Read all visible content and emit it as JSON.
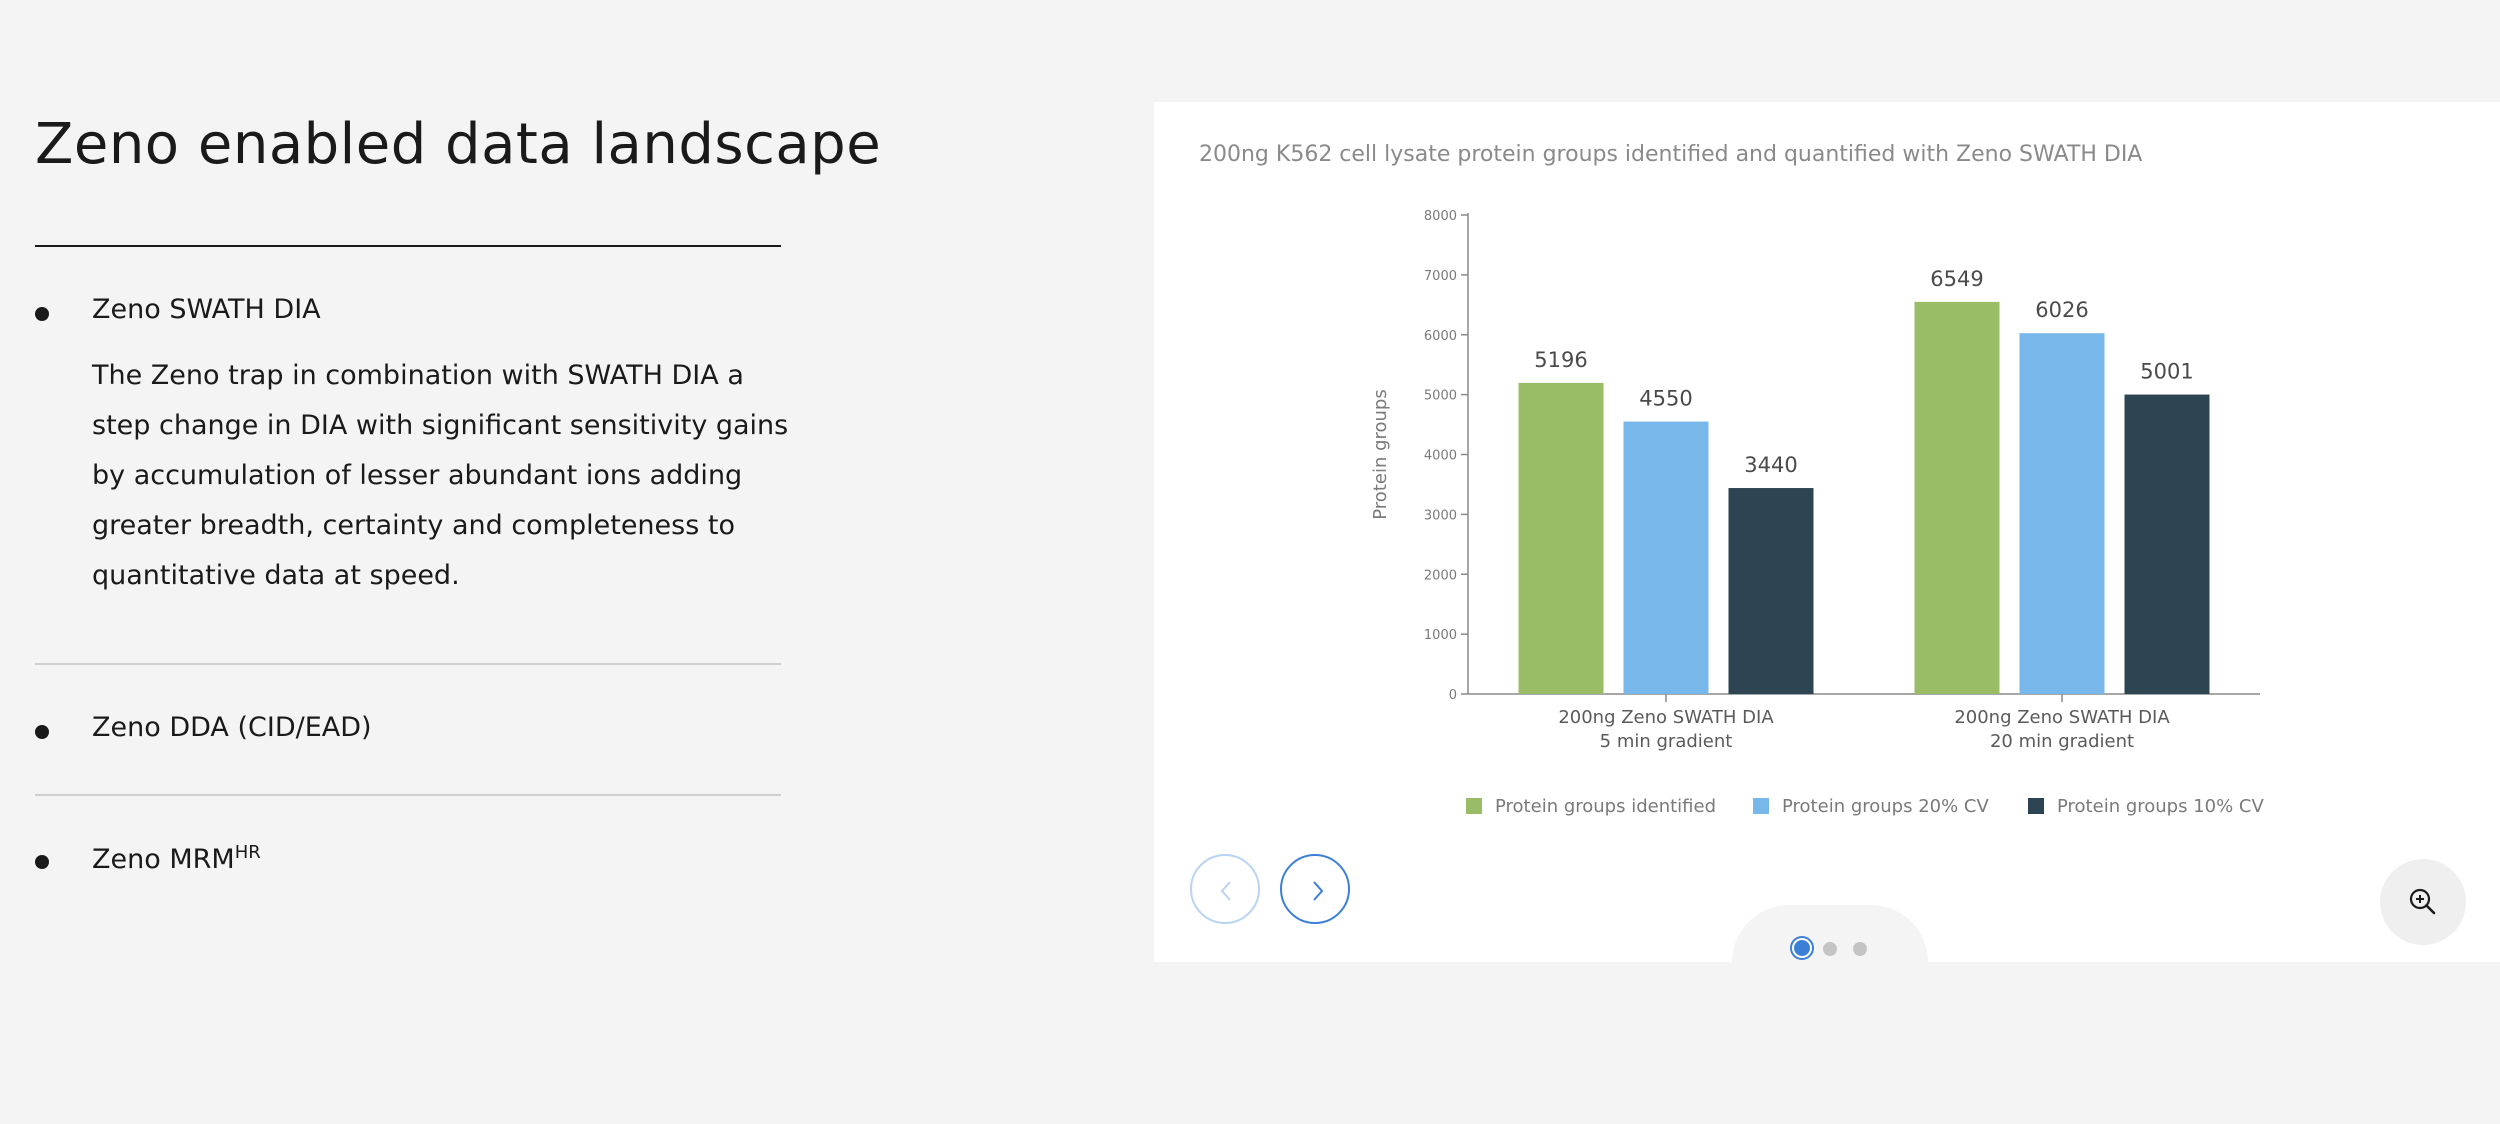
{
  "page": {
    "title": "Zeno enabled data landscape"
  },
  "accordion": {
    "items": [
      {
        "label": "Zeno SWATH DIA",
        "body": "The Zeno trap in combination with SWATH DIA a step change in DIA with significant sensitivity gains by accumulation of lesser abundant ions adding greater breadth, certainty and completeness to quantitative data at speed."
      },
      {
        "label": "Zeno DDA (CID/EAD)"
      },
      {
        "label": "Zeno MRM",
        "label_sup": "HR"
      }
    ]
  },
  "carousel": {
    "prev_icon": "chevron-left-icon",
    "next_icon": "chevron-right-icon",
    "zoom_icon": "zoom-in-icon",
    "slide_count": 3,
    "active_slide": 1
  },
  "colors": {
    "accent": "#3b7fd6",
    "identified": "#99bd66",
    "cv20": "#78b7ea",
    "cv10": "#2d4453"
  },
  "chart_data": {
    "type": "bar",
    "title": "200ng K562 cell lysate protein groups identified and quantified with Zeno SWATH DIA",
    "ylabel": "Protein groups",
    "xlabel": "",
    "ylim": [
      0,
      8000
    ],
    "yticks": [
      0,
      1000,
      2000,
      3000,
      4000,
      5000,
      6000,
      7000,
      8000
    ],
    "categories": [
      [
        "200ng Zeno SWATH DIA",
        "5 min gradient"
      ],
      [
        "200ng Zeno SWATH DIA",
        "20 min gradient"
      ]
    ],
    "series": [
      {
        "name": "Protein groups identified",
        "color": "#99bd66",
        "values": [
          5196,
          6549
        ]
      },
      {
        "name": "Protein groups 20% CV",
        "color": "#78b7ea",
        "values": [
          4550,
          6026
        ]
      },
      {
        "name": "Protein groups 10% CV",
        "color": "#2d4453",
        "values": [
          3440,
          5001
        ]
      }
    ],
    "grid": false,
    "legend": "bottom",
    "data_labels": true
  }
}
